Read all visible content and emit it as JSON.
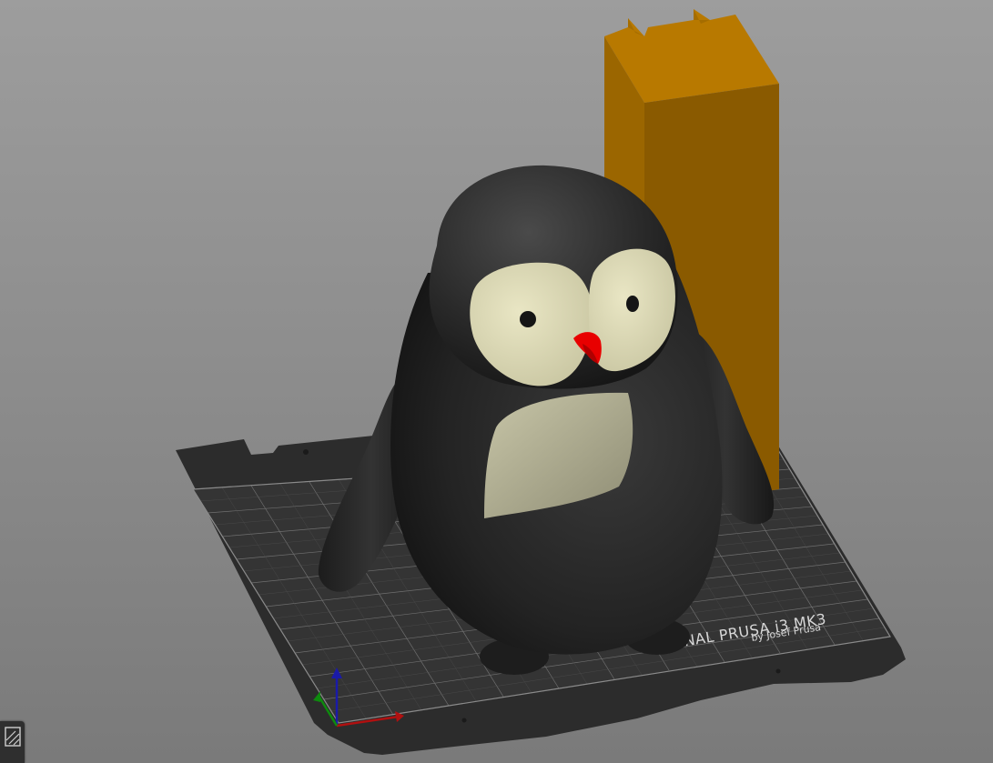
{
  "scene": {
    "plate_brand": "ORIGINAL PRUSA i3 MK3",
    "plate_sub": "by Josef Prusa",
    "objects": [
      "penguin-model",
      "wipe-tower"
    ],
    "colors": {
      "background_top": "#9d9d9d",
      "background_bottom": "#7a7a7a",
      "bed": "#2b2b2b",
      "wipe_tower": "#b07400",
      "penguin_body": "#262626",
      "face": "#d9d6b2",
      "beak": "#e80000"
    }
  },
  "controls": {
    "layers_button_icon": "layers-icon"
  }
}
